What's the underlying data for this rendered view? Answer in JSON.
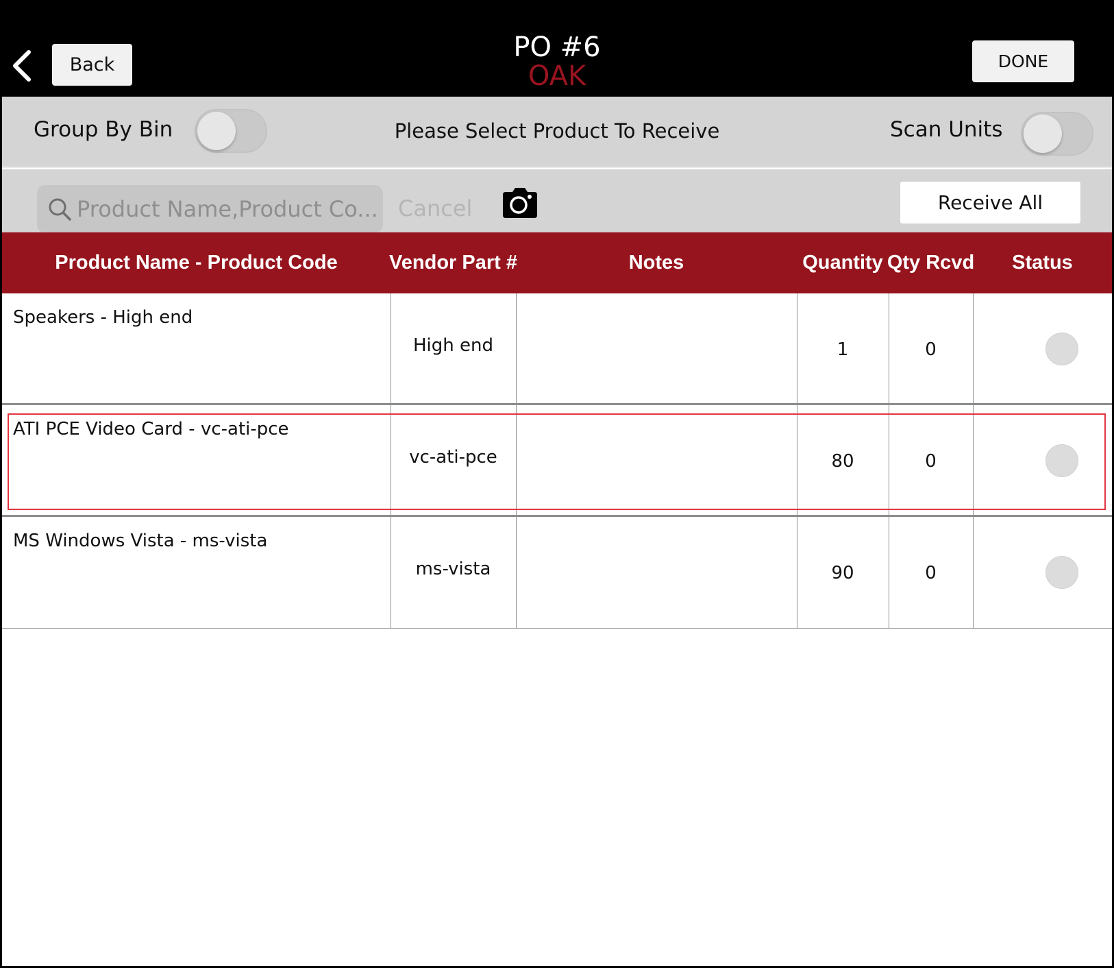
{
  "header": {
    "back_label": "Back",
    "po_title": "PO #6",
    "location": "OAK",
    "done_label": "DONE"
  },
  "options": {
    "group_by_bin_label": "Group By Bin",
    "group_by_bin_on": false,
    "prompt": "Please Select Product To Receive",
    "scan_units_label": "Scan Units",
    "scan_units_on": false
  },
  "search": {
    "placeholder": "Product Name,Product Co...",
    "cancel_label": "Cancel",
    "receive_all_label": "Receive All"
  },
  "table": {
    "columns": [
      "Product Name - Product Code",
      "Vendor Part #",
      "Notes",
      "Quantity",
      "Qty Rcvd",
      "Status"
    ],
    "rows": [
      {
        "name": "Speakers - High end",
        "vendor_part": "High end",
        "notes": "",
        "quantity": "1",
        "qty_rcvd": "0"
      },
      {
        "name": "ATI PCE Video Card - vc-ati-pce",
        "vendor_part": "vc-ati-pce",
        "notes": "",
        "quantity": "80",
        "qty_rcvd": "0"
      },
      {
        "name": "MS Windows Vista - ms-vista",
        "vendor_part": "ms-vista",
        "notes": "",
        "quantity": "90",
        "qty_rcvd": "0"
      }
    ]
  },
  "colors": {
    "accent": "#96141d",
    "location": "#9a1420",
    "selection_outline": "#e2353f"
  }
}
